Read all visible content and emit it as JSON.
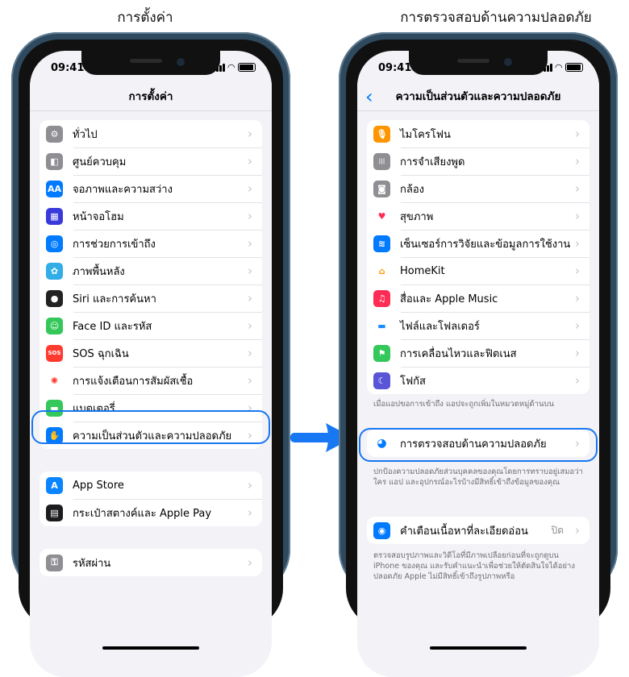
{
  "captions": {
    "left": "การตั้งค่า",
    "right": "การตรวจสอบด้านความปลอดภัย"
  },
  "status": {
    "time": "09:41"
  },
  "left_screen": {
    "title": "การตั้งค่า",
    "group1": [
      {
        "label": "ทั่วไป",
        "icon": "gear-icon",
        "color": "#8e8e93"
      },
      {
        "label": "ศูนย์ควบคุม",
        "icon": "toggles-icon",
        "color": "#8e8e93"
      },
      {
        "label": "จอภาพและความสว่าง",
        "icon": "text-size-icon",
        "color": "#007aff"
      },
      {
        "label": "หน้าจอโฮม",
        "icon": "grid-icon",
        "color": "#3a3adc"
      },
      {
        "label": "การช่วยการเข้าถึง",
        "icon": "accessibility-icon",
        "color": "#007aff"
      },
      {
        "label": "ภาพพื้นหลัง",
        "icon": "flower-icon",
        "color": "#32ade6"
      },
      {
        "label": "Siri และการค้นหา",
        "icon": "siri-icon",
        "color": "#222222"
      },
      {
        "label": "Face ID และรหัส",
        "icon": "face-id-icon",
        "color": "#34c759"
      },
      {
        "label": "SOS ฉุกเฉิน",
        "icon": "sos-icon",
        "color": "#ff3b30"
      },
      {
        "label": "การแจ้งเตือนการสัมผัสเชื้อ",
        "icon": "exposure-icon",
        "color": "#ffffff"
      },
      {
        "label": "แบตเตอรี่",
        "icon": "battery-icon",
        "color": "#34c759"
      },
      {
        "label": "ความเป็นส่วนตัวและความปลอดภัย",
        "icon": "hand-icon",
        "color": "#007aff"
      }
    ],
    "group2": [
      {
        "label": "App Store",
        "icon": "app-store-icon",
        "color": "#0a84ff"
      },
      {
        "label": "กระเป๋าสตางค์และ Apple Pay",
        "icon": "wallet-icon",
        "color": "#1c1c1e"
      }
    ],
    "group3": [
      {
        "label": "รหัสผ่าน",
        "icon": "key-icon",
        "color": "#8e8e93"
      }
    ]
  },
  "right_screen": {
    "title": "ความเป็นส่วนตัวและความปลอดภัย",
    "group1": [
      {
        "label": "ไมโครโฟน",
        "icon": "microphone-icon",
        "color": "#ff9500"
      },
      {
        "label": "การจำเสียงพูด",
        "icon": "waveform-icon",
        "color": "#8e8e93"
      },
      {
        "label": "กล้อง",
        "icon": "camera-icon",
        "color": "#8e8e93"
      },
      {
        "label": "สุขภาพ",
        "icon": "health-icon",
        "color": "#ffffff"
      },
      {
        "label": "เซ็นเซอร์การวิจัยและข้อมูลการใช้งาน",
        "icon": "research-icon",
        "color": "#007aff"
      },
      {
        "label": "HomeKit",
        "icon": "home-icon",
        "color": "#ffffff"
      },
      {
        "label": "สื่อและ Apple Music",
        "icon": "music-icon",
        "color": "#ff2d55"
      },
      {
        "label": "ไฟล์และโฟลเดอร์",
        "icon": "folder-icon",
        "color": "#ffffff"
      },
      {
        "label": "การเคลื่อนไหวและฟิตเนส",
        "icon": "fitness-icon",
        "color": "#34c759"
      },
      {
        "label": "โฟกัส",
        "icon": "moon-icon",
        "color": "#5856d6"
      }
    ],
    "group1_note": "เมื่อแอปขอการเข้าถึง แอปจะถูกเพิ่มในหมวดหมู่ด้านบน",
    "safety_check": {
      "label": "การตรวจสอบด้านความปลอดภัย",
      "icon": "safety-check-icon",
      "color": "#ffffff"
    },
    "safety_note": "ปกป้องความปลอดภัยส่วนบุคคลของคุณโดยการทราบอยู่เสมอว่าใคร แอป และอุปกรณ์อะไรบ้างมีสิทธิ์เข้าถึงข้อมูลของคุณ",
    "sensitive": {
      "label": "คำเตือนเนื้อหาที่ละเอียดอ่อน",
      "value": "ปิด",
      "icon": "eye-warning-icon",
      "color": "#007aff"
    },
    "sensitive_note": "ตรวจสอบรูปภาพและวิดีโอที่มีภาพเปลือยก่อนที่จะถูกดูบน iPhone ของคุณ และรับคำแนะนำเพื่อช่วยให้ตัดสินใจได้อย่างปลอดภัย Apple ไม่มีสิทธิ์เข้าถึงรูปภาพหรือ"
  }
}
